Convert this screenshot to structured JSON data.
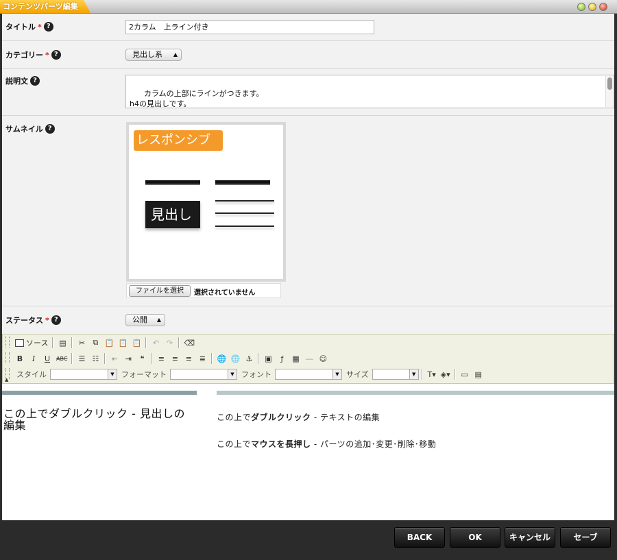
{
  "window": {
    "title": "コンテンツパーツ編集",
    "buttons": [
      "minimize",
      "maximize",
      "close"
    ]
  },
  "form": {
    "title_field": {
      "label": "タイトル",
      "required_mark": "*",
      "value": "2カラム　上ライン付き"
    },
    "category_field": {
      "label": "カテゴリー",
      "required_mark": "*",
      "selected": "見出し系"
    },
    "description_field": {
      "label": "説明文",
      "value": "カラムの上部にラインがつきます。\nh4の見出しです。\n※見出しは改行、複数行に対応しています。"
    },
    "thumbnail_field": {
      "label": "サムネイル",
      "image_badge": "レスポンシブ",
      "image_heading": "見出し",
      "file_button": "ファイルを選択",
      "file_status": "選択されていません"
    },
    "status_field": {
      "label": "ステータス",
      "required_mark": "*",
      "selected": "公開"
    },
    "help_glyph": "?"
  },
  "editor": {
    "source_label": "ソース",
    "style_label": "スタイル",
    "format_label": "フォーマット",
    "font_label": "フォント",
    "size_label": "サイズ",
    "toolbar_icons": [
      "source-icon",
      "paste-text-icon",
      "cut-icon",
      "copy-icon",
      "paste-icon",
      "paste-word-icon",
      "paste-special-icon",
      "undo-icon",
      "redo-icon",
      "eraser-icon",
      "bold-icon",
      "italic-icon",
      "underline-icon",
      "strike-icon",
      "ordered-list-icon",
      "bullet-list-icon",
      "outdent-icon",
      "indent-icon",
      "blockquote-icon",
      "align-left-icon",
      "align-center-icon",
      "align-right-icon",
      "justify-icon",
      "link-icon",
      "unlink-icon",
      "anchor-icon",
      "image-icon",
      "flash-icon",
      "table-icon",
      "hr-icon",
      "smiley-icon",
      "text-color-icon",
      "bg-color-icon",
      "maximize-icon",
      "show-blocks-icon"
    ]
  },
  "canvas": {
    "left_heading": "この上でダブルクリック - 見出しの編集",
    "hint1": {
      "prefix": "この上で",
      "action": "ダブルクリック",
      "suffix": " - テキストの編集"
    },
    "hint2": {
      "prefix": "この上で",
      "action": "マウスを長押し",
      "suffix": " - パーツの追加･変更･削除･移動"
    }
  },
  "footer": {
    "back": "BACK",
    "ok": "OK",
    "cancel": "キャンセル",
    "save": "セーブ"
  }
}
